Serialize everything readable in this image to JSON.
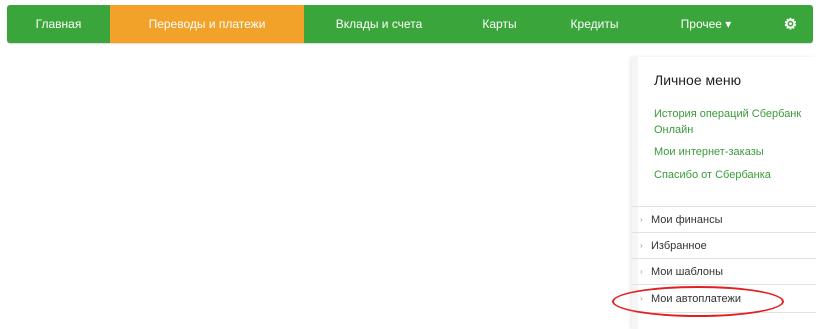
{
  "nav": {
    "items": [
      {
        "label": "Главная"
      },
      {
        "label": "Переводы и платежи"
      },
      {
        "label": "Вклады и счета"
      },
      {
        "label": "Карты"
      },
      {
        "label": "Кредиты"
      },
      {
        "label": "Прочее ▾"
      }
    ],
    "settings_icon": "gear-icon",
    "active_color": "#f2a229",
    "bar_color": "#3aa53a"
  },
  "personal_menu": {
    "title": "Личное меню",
    "links": [
      {
        "label": "История операций Сбербанк Онлайн"
      },
      {
        "label": "Мои интернет-заказы"
      },
      {
        "label": "Спасибо от Сбербанка"
      }
    ],
    "sections": [
      {
        "label": "Мои финансы"
      },
      {
        "label": "Избранное"
      },
      {
        "label": "Мои шаблоны"
      },
      {
        "label": "Мои автоплатежи"
      }
    ]
  }
}
